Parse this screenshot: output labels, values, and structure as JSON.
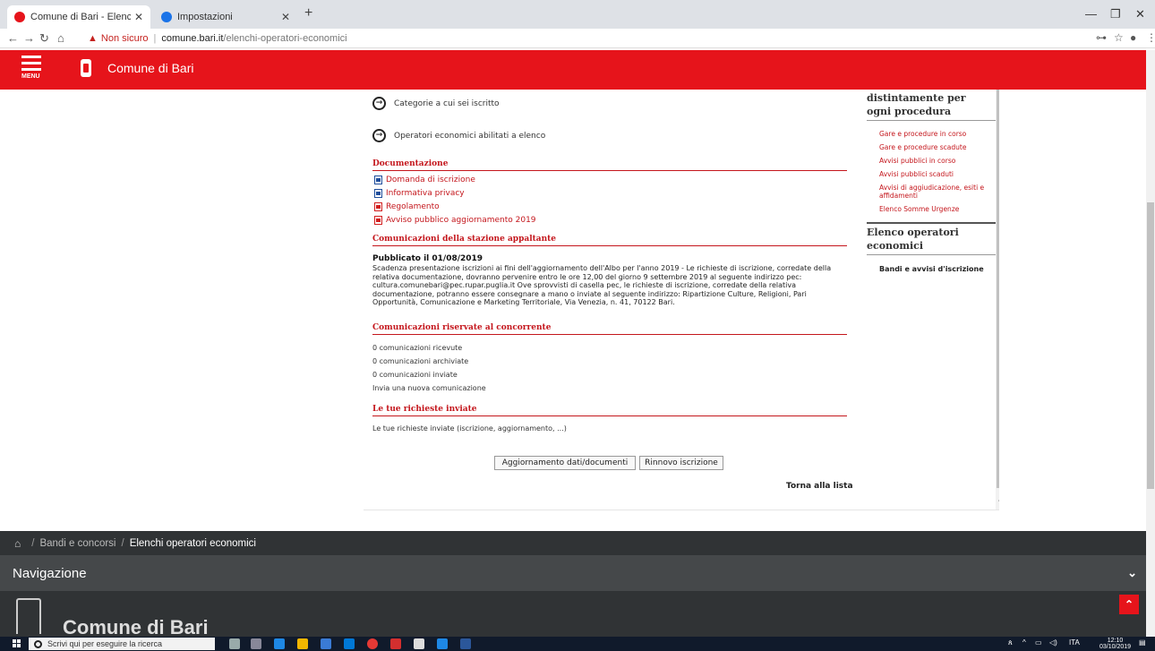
{
  "browser": {
    "tabs": [
      {
        "title": "Comune di Bari - Elenchi operat",
        "active": true
      },
      {
        "title": "Impostazioni",
        "active": false
      }
    ],
    "new_tab": "+",
    "address": {
      "warning": "Non sicuro",
      "host": "comune.bari.it",
      "path": "/elenchi-operatori-economici"
    }
  },
  "site": {
    "menu_label": "MENU",
    "name": "Comune di Bari",
    "accent": "#e6141b"
  },
  "main": {
    "links": [
      "Categorie a cui sei iscritto",
      "Operatori economici abilitati a elenco"
    ],
    "documentazione": {
      "title": "Documentazione",
      "docs": [
        {
          "label": "Domanda di iscrizione",
          "icon": "word-doc-icon"
        },
        {
          "label": "Informativa privacy",
          "icon": "word-doc-icon"
        },
        {
          "label": "Regolamento",
          "icon": "pdf-icon"
        },
        {
          "label": "Avviso pubblico aggiornamento 2019",
          "icon": "pdf-icon"
        }
      ]
    },
    "comunicazioni_stazione": {
      "title": "Comunicazioni della stazione appaltante",
      "date": "Pubblicato il 01/08/2019",
      "text": "Scadenza presentazione iscrizioni ai fini dell'aggiornamento dell'Albo per l'anno 2019 - Le richieste di iscrizione, corredate della relativa documentazione, dovranno pervenire entro le ore 12,00 del giorno 9 settembre 2019 al seguente indirizzo pec: cultura.comunebari@pec.rupar.puglia.it Ove sprovvisti di casella pec, le richieste di iscrizione, corredate della relativa documentazione, potranno essere consegnare a mano o inviate al seguente indirizzo: Ripartizione Culture, Religioni, Pari Opportunità, Comunicazione e Marketing Territoriale, Via Venezia, n. 41, 70122 Bari."
    },
    "comunicazioni_riservate": {
      "title": "Comunicazioni riservate al concorrente",
      "items": [
        "0 comunicazioni ricevute",
        "0 comunicazioni archiviate",
        "0 comunicazioni inviate",
        "Invia una nuova comunicazione"
      ]
    },
    "richieste": {
      "title": "Le tue richieste inviate",
      "text": "Le tue richieste inviate (iscrizione, aggiornamento, ...)"
    },
    "buttons": {
      "aggiornamento": "Aggiornamento dati/documenti",
      "rinnovo": "Rinnovo iscrizione"
    },
    "torna": "Torna alla lista"
  },
  "sidebar": {
    "heading1_line1": "distintamente per",
    "heading1_line2": "ogni procedura",
    "links": [
      "Gare e procedure in corso",
      "Gare e procedure scadute",
      "Avvisi pubblici in corso",
      "Avvisi pubblici scaduti",
      "Avvisi di aggiudicazione, esiti e affidamenti",
      "Elenco Somme Urgenze"
    ],
    "heading2_line1": "Elenco operatori",
    "heading2_line2": "economici",
    "bold_link": "Bandi e avvisi d'iscrizione"
  },
  "breadcrumb": {
    "items": [
      "Bandi e concorsi"
    ],
    "current": "Elenchi operatori economici"
  },
  "navigation": {
    "label": "Navigazione"
  },
  "footer": {
    "name": "Comune di Bari"
  },
  "taskbar": {
    "search_placeholder": "Scrivi qui per eseguire la ricerca",
    "lang": "ITA",
    "time": "12:10",
    "date": "03/10/2019"
  }
}
